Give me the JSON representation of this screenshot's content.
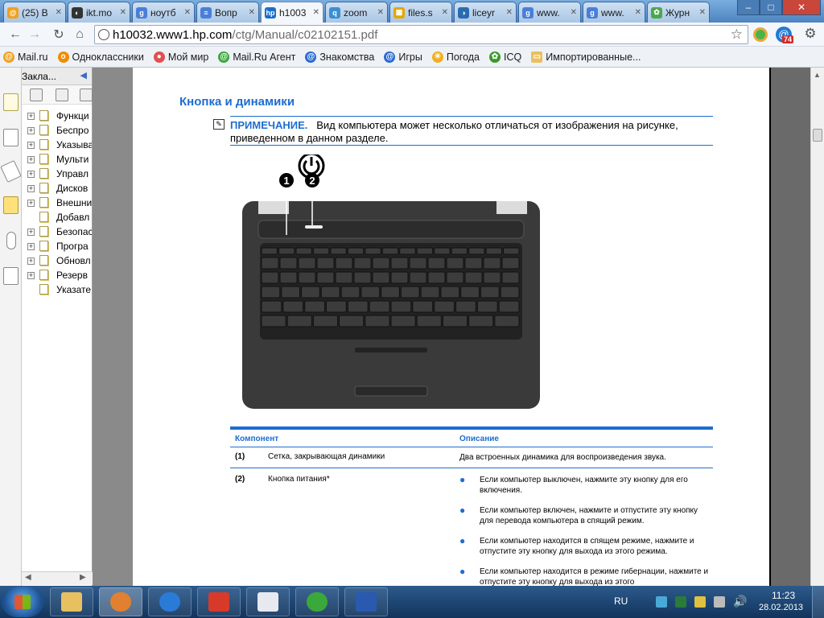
{
  "browser": {
    "tabs": [
      {
        "label": "(25) В",
        "icon": "mail-ru-icon",
        "color": "#f0a020"
      },
      {
        "label": "ikt.mo",
        "icon": "panda-icon",
        "color": "#333333"
      },
      {
        "label": "ноутб",
        "icon": "google-icon",
        "color": "#4a7fd8"
      },
      {
        "label": "Вопр",
        "icon": "book-icon",
        "color": "#4a7fd8"
      },
      {
        "label": "h1003",
        "icon": "hp-icon",
        "color": "#1b6fc8",
        "active": true
      },
      {
        "label": "zoom",
        "icon": "qip-icon",
        "color": "#3a8fd0"
      },
      {
        "label": "files.s",
        "icon": "grid-icon",
        "color": "#e0a800"
      },
      {
        "label": "liceyr",
        "icon": "globe-icon",
        "color": "#2a6bb0"
      },
      {
        "label": "www.",
        "icon": "google-icon",
        "color": "#4a7fd8"
      },
      {
        "label": "www.",
        "icon": "google-icon",
        "color": "#4a7fd8"
      },
      {
        "label": "Журн",
        "icon": "leaf-icon",
        "color": "#4aa84a"
      }
    ],
    "window_controls": {
      "minimize": "–",
      "maximize": "□",
      "close": "✕"
    },
    "address": {
      "host": "h10032.www1.hp.com",
      "path": "/ctg/Manual/c02102151.pdf"
    },
    "badge_count": "74",
    "bookmarks": [
      {
        "label": "Mail.ru",
        "icon": "mail-ru-icon",
        "color": "#f0a020"
      },
      {
        "label": "Одноклассники",
        "icon": "ok-icon",
        "color": "#f08c00"
      },
      {
        "label": "Мой мир",
        "icon": "my-world-icon",
        "color": "#e05050"
      },
      {
        "label": "Mail.Ru Агент",
        "icon": "agent-icon",
        "color": "#3aa83a"
      },
      {
        "label": "Знакомства",
        "icon": "at-icon",
        "color": "#2a6bd0"
      },
      {
        "label": "Игры",
        "icon": "at-icon",
        "color": "#2a6bd0"
      },
      {
        "label": "Погода",
        "icon": "weather-icon",
        "color": "#f0b020"
      },
      {
        "label": "ICQ",
        "icon": "icq-icon",
        "color": "#3a9a2a"
      },
      {
        "label": "Импортированные...",
        "icon": "folder-icon",
        "color": "#e8c060"
      }
    ]
  },
  "reader": {
    "bookmarks_title": "Закла...",
    "tree": [
      {
        "label": "Функци",
        "expandable": true
      },
      {
        "label": "Беспро",
        "expandable": true
      },
      {
        "label": "Указыва",
        "expandable": true
      },
      {
        "label": "Мульти",
        "expandable": true
      },
      {
        "label": "Управл",
        "expandable": true
      },
      {
        "label": "Дисков",
        "expandable": true
      },
      {
        "label": "Внешни",
        "expandable": true
      },
      {
        "label": "Добавл",
        "expandable": false
      },
      {
        "label": "Безопас",
        "expandable": true
      },
      {
        "label": "Програ",
        "expandable": true
      },
      {
        "label": "Обновл",
        "expandable": true
      },
      {
        "label": "Резерв",
        "expandable": true
      },
      {
        "label": "Указате",
        "expandable": false
      }
    ]
  },
  "page": {
    "heading": "Кнопка и динамики",
    "note_label": "ПРИМЕЧАНИЕ.",
    "note_text": "Вид компьютера может несколько отличаться от изображения на рисунке, приведенном в данном разделе.",
    "callouts": [
      "1",
      "2"
    ],
    "table": {
      "headers": [
        "Компонент",
        "Описание"
      ],
      "rows": [
        {
          "num": "(1)",
          "name": "Сетка, закрывающая динамики",
          "desc": "Два встроенных динамика для воспроизведения звука."
        },
        {
          "num": "(2)",
          "name": "Кнопка питания*",
          "bullets": [
            "Если компьютер выключен, нажмите эту кнопку для его включения.",
            "Если компьютер включен, нажмите и отпустите эту кнопку для перевода компьютера в спящий режим.",
            "Если компьютер находится в спящем режиме, нажмите и отпустите эту кнопку для выхода из этого режима.",
            "Если компьютер находится в режиме гибернации, нажмите и отпустите эту кнопку для выхода из этого"
          ]
        }
      ]
    }
  },
  "taskbar": {
    "apps": [
      {
        "name": "explorer",
        "icon": "folder-icon"
      },
      {
        "name": "chrome-ball",
        "icon": "browser-icon",
        "active": true
      },
      {
        "name": "mail-ru",
        "icon": "at-icon"
      },
      {
        "name": "yandex",
        "icon": "yandex-icon"
      },
      {
        "name": "mail",
        "icon": "envelope-icon"
      },
      {
        "name": "agent",
        "icon": "agent-icon"
      },
      {
        "name": "word",
        "icon": "word-icon"
      }
    ],
    "language": "RU",
    "time": "11:23",
    "date": "28.02.2013"
  }
}
